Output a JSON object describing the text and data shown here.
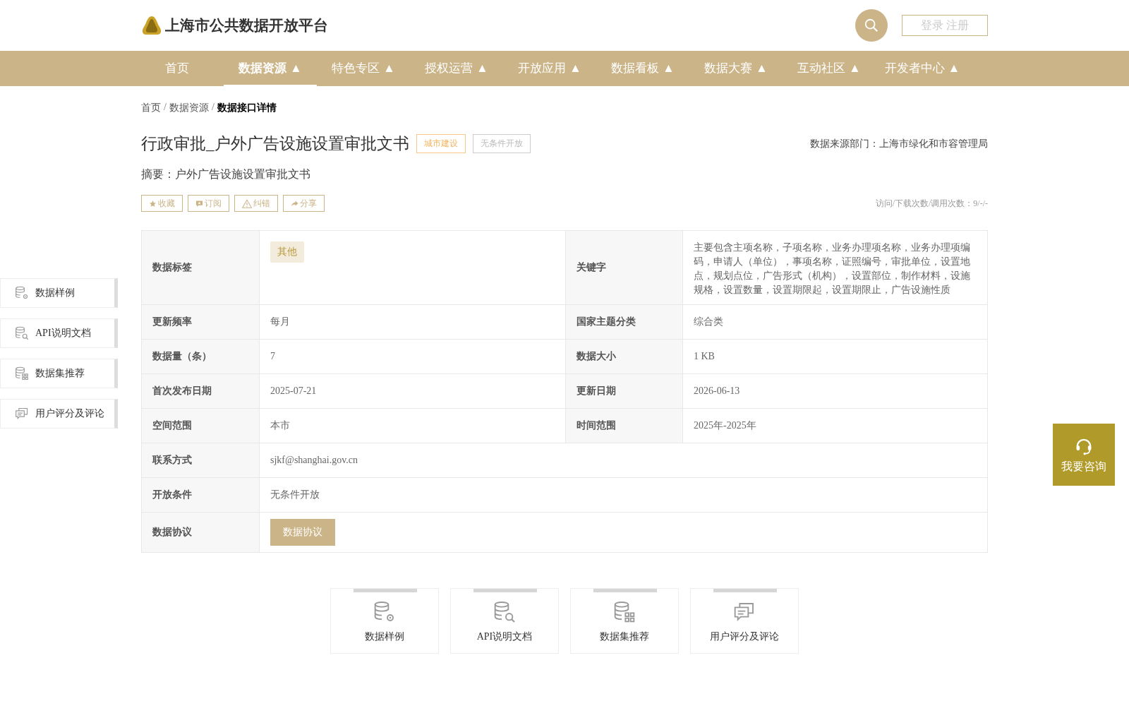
{
  "site": {
    "title": "上海市公共数据开放平台",
    "login": "登录 注册"
  },
  "nav": [
    {
      "label": "首页",
      "selected": false
    },
    {
      "label": "数据资源 ▲",
      "selected": true
    },
    {
      "label": "特色专区 ▲",
      "selected": false
    },
    {
      "label": "授权运营 ▲",
      "selected": false
    },
    {
      "label": "开放应用 ▲",
      "selected": false
    },
    {
      "label": "数据看板 ▲",
      "selected": false
    },
    {
      "label": "数据大赛 ▲",
      "selected": false
    },
    {
      "label": "互动社区 ▲",
      "selected": false
    },
    {
      "label": "开发者中心 ▲",
      "selected": false
    }
  ],
  "breadcrumb": [
    {
      "label": "首页",
      "current": false
    },
    {
      "label": "数据资源",
      "current": false
    },
    {
      "label": "数据接口详情",
      "current": true
    }
  ],
  "breadcrumb_separator": "/",
  "dataset": {
    "title": "行政审批_户外广告设施设置审批文书",
    "tags": [
      {
        "label": "城市建设",
        "kind": "category"
      },
      {
        "label": "无条件开放",
        "kind": "access"
      }
    ],
    "source": "数据来源部门：上海市绿化和市容管理局",
    "summary": "摘要：户外广告设施设置审批文书",
    "actions": [
      "收藏",
      "订阅",
      "纠错",
      "分享"
    ],
    "stats": "访问/下载次数/调用次数：9/-/-"
  },
  "table": [
    {
      "kind": "pair",
      "cells": [
        {
          "label": "数据标签",
          "value": "其他",
          "kind": "tag"
        },
        {
          "label": "关键字",
          "value": "主要包含主项名称，子项名称，业务办理项名称，业务办理项编码，申请人（单位），事项名称，证照编号，审批单位，设置地点，规划点位，广告形式（机构），设置部位，制作材料，设施规格，设置数量，设置期限起，设置期限止，广告设施性质",
          "kind": "text"
        }
      ]
    },
    {
      "kind": "pair",
      "cells": [
        {
          "label": "更新频率",
          "value": "每月",
          "kind": "text"
        },
        {
          "label": "国家主题分类",
          "value": "综合类",
          "kind": "text"
        }
      ]
    },
    {
      "kind": "pair",
      "cells": [
        {
          "label": "数据量（条）",
          "value": "7",
          "kind": "text"
        },
        {
          "label": "数据大小",
          "value": "1 KB",
          "kind": "text"
        }
      ]
    },
    {
      "kind": "pair",
      "cells": [
        {
          "label": "首次发布日期",
          "value": "2025-07-21",
          "kind": "text"
        },
        {
          "label": "更新日期",
          "value": "2026-06-13",
          "kind": "text"
        }
      ]
    },
    {
      "kind": "pair",
      "cells": [
        {
          "label": "空间范围",
          "value": "本市",
          "kind": "text"
        },
        {
          "label": "时间范围",
          "value": "2025年-2025年",
          "kind": "text"
        }
      ]
    },
    {
      "kind": "full",
      "cells": [
        {
          "label": "联系方式",
          "value": "sjkf@shanghai.gov.cn",
          "kind": "text"
        }
      ]
    },
    {
      "kind": "full",
      "cells": [
        {
          "label": "开放条件",
          "value": "无条件开放",
          "kind": "text"
        }
      ]
    },
    {
      "kind": "full",
      "cells": [
        {
          "label": "数据协议",
          "value": "数据协议",
          "kind": "button"
        }
      ]
    }
  ],
  "side_tabs": [
    "数据样例",
    "API说明文档",
    "数据集推荐",
    "用户评分及评论"
  ],
  "cards": [
    "数据样例",
    "API说明文档",
    "数据集推荐",
    "用户评分及评论"
  ],
  "consult": {
    "label": "我要咨询"
  }
}
